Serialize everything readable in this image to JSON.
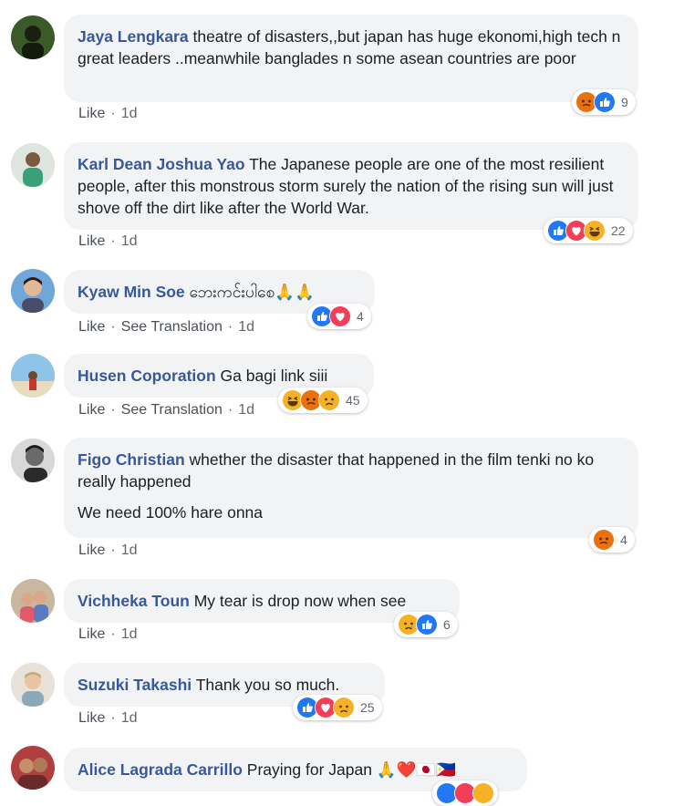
{
  "colors": {
    "author": "#385898",
    "bubble": "#f2f3f5",
    "like": "#2078f4",
    "love": "#f33e58",
    "haha": "#f7b125",
    "angry": "#e9710f"
  },
  "action_labels": {
    "like": "Like",
    "see_translation": "See Translation",
    "separator": "·"
  },
  "comments": [
    {
      "author": "Jaya Lengkara",
      "lines": [
        "theatre of disasters,,but japan has huge ekonomi,high tech n great leaders ..meanwhile banglades n some asean countries are poor"
      ],
      "time": "1d",
      "reaction_count": "9",
      "reactions": [
        "angry-icon",
        "like-icon"
      ]
    },
    {
      "author": "Karl Dean Joshua Yao",
      "lines": [
        "The Japanese people are one of the most resilient people, after this monstrous storm surely the nation of the rising sun will just shove off the dirt like after the World War."
      ],
      "time": "1d",
      "reaction_count": "22",
      "reactions": [
        "like-icon",
        "love-icon",
        "haha-icon"
      ]
    },
    {
      "author": "Kyaw Min Soe",
      "lines": [
        "ဘေးကင်းပါစေ🙏🙏"
      ],
      "time": "1d",
      "reaction_count": "4",
      "reactions": [
        "like-icon",
        "love-icon"
      ],
      "has_translation": true
    },
    {
      "author": "Husen Coporation",
      "lines": [
        "Ga bagi link siii"
      ],
      "time": "1d",
      "reaction_count": "45",
      "reactions": [
        "haha-icon",
        "angry-icon",
        "sad-icon"
      ],
      "has_translation": true
    },
    {
      "author": "Figo Christian",
      "lines": [
        "whether the disaster that happened in the film tenki no ko really happened",
        "We need 100% hare onna"
      ],
      "time": "1d",
      "reaction_count": "4",
      "reactions": [
        "angry-icon"
      ]
    },
    {
      "author": "Vichheka Toun",
      "lines": [
        "My tear is drop now when see"
      ],
      "time": "1d",
      "reaction_count": "6",
      "reactions": [
        "sad-icon",
        "like-icon"
      ]
    },
    {
      "author": "Suzuki Takashi",
      "lines": [
        "Thank you so much."
      ],
      "time": "1d",
      "reaction_count": "25",
      "reactions": [
        "like-icon",
        "love-icon",
        "sad-icon"
      ]
    },
    {
      "author": "Alice Lagrada Carrillo",
      "lines": [
        "Praying for Japan 🙏❤️🇯🇵🇵🇭"
      ],
      "time": "",
      "reaction_count": "",
      "reactions": [
        "like-icon",
        "love-icon",
        "haha-icon"
      ]
    }
  ]
}
